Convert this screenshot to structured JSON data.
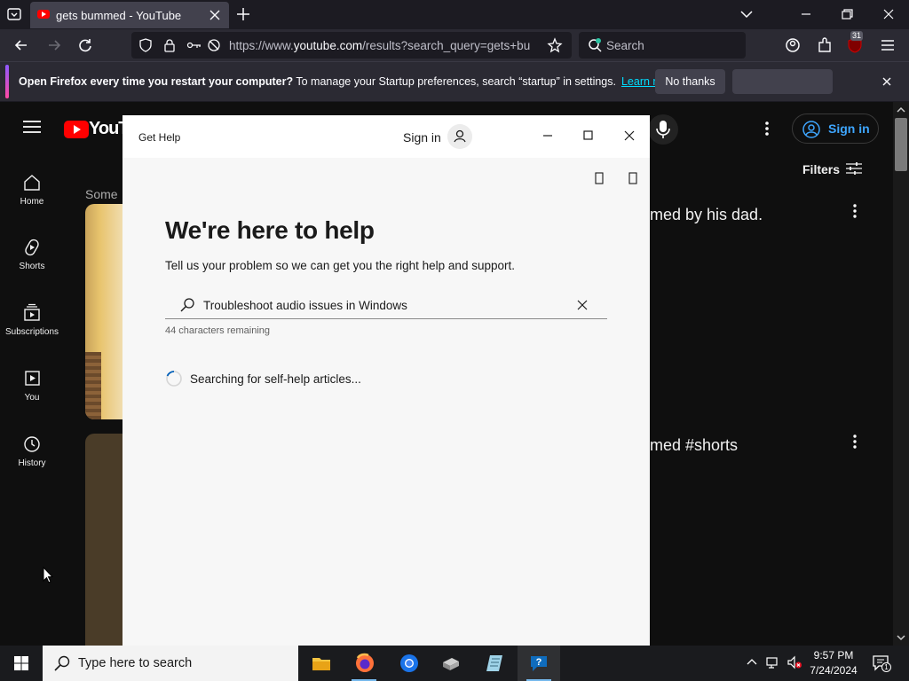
{
  "browser": {
    "tab_title": "gets bummed - YouTube",
    "url_prefix": "https://www.",
    "url_host": "youtube.com",
    "url_path": "/results?search_query=gets+bu",
    "search_placeholder": "Search",
    "extension_badge": "31"
  },
  "notification": {
    "bold": "Open Firefox every time you restart your computer?",
    "text": " To manage your Startup preferences, search “startup” in settings.",
    "learn_more": "Learn more",
    "no_thanks": "No thanks"
  },
  "youtube": {
    "logo_text": "YouTu",
    "sidebar": [
      {
        "label": "Home"
      },
      {
        "label": "Shorts"
      },
      {
        "label": "Subscriptions"
      },
      {
        "label": "You"
      },
      {
        "label": "History"
      }
    ],
    "some_label": "Some",
    "video1_title": "med by his dad.",
    "video2_title": "med #shorts",
    "sign_in": "Sign in",
    "filters": "Filters"
  },
  "get_help": {
    "window_title": "Get Help",
    "sign_in": "Sign in",
    "heading": "We're here to help",
    "subheading": "Tell us your problem so we can get you the right help and support.",
    "query": "Troubleshoot audio issues in Windows",
    "remaining": "44 characters remaining",
    "status": "Searching for self-help articles..."
  },
  "taskbar": {
    "search_placeholder": "Type here to search",
    "time": "9:57 PM",
    "date": "7/24/2024",
    "notification_count": "1"
  },
  "colors": {
    "accent": "#3ea6ff",
    "youtube_red": "#ff0000",
    "link": "#00ddff"
  }
}
